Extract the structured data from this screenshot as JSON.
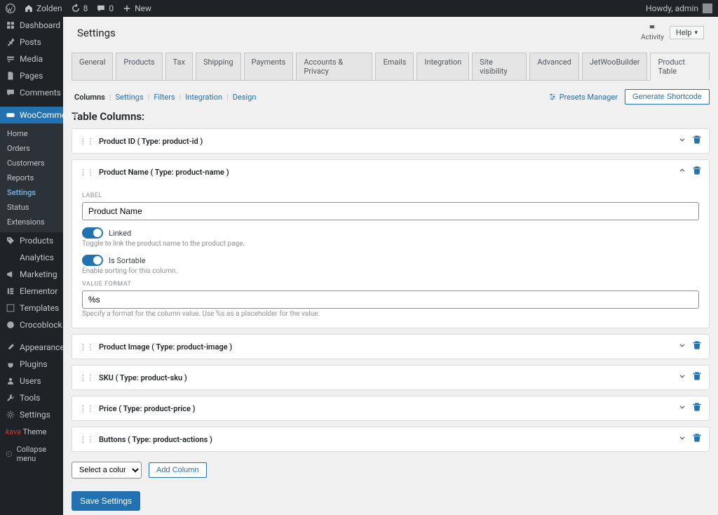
{
  "topbar": {
    "site_name": "Zolden",
    "updates_count": "8",
    "comments_count": "0",
    "new_label": "New",
    "howdy": "Howdy, admin"
  },
  "sidebar": {
    "items": [
      {
        "icon": "dashboard",
        "label": "Dashboard"
      },
      {
        "icon": "pin",
        "label": "Posts"
      },
      {
        "icon": "media",
        "label": "Media"
      },
      {
        "icon": "page",
        "label": "Pages"
      },
      {
        "icon": "comment",
        "label": "Comments"
      },
      {
        "icon": "woo",
        "label": "WooCommerce",
        "active": true
      },
      {
        "icon": "tag",
        "label": "Products"
      },
      {
        "icon": "chart",
        "label": "Analytics"
      },
      {
        "icon": "megaphone",
        "label": "Marketing"
      },
      {
        "icon": "elementor",
        "label": "Elementor"
      },
      {
        "icon": "template",
        "label": "Templates"
      },
      {
        "icon": "croco",
        "label": "Crocoblock"
      },
      {
        "icon": "brush",
        "label": "Appearance"
      },
      {
        "icon": "plugin",
        "label": "Plugins"
      },
      {
        "icon": "user",
        "label": "Users"
      },
      {
        "icon": "tool",
        "label": "Tools"
      },
      {
        "icon": "gear",
        "label": "Settings"
      }
    ],
    "submenu": [
      "Home",
      "Orders",
      "Customers",
      "Reports",
      "Settings",
      "Status",
      "Extensions"
    ],
    "submenu_active": "Settings",
    "theme_prefix": "kava",
    "theme_label": "Theme",
    "collapse_label": "Collapse menu"
  },
  "header": {
    "title": "Settings",
    "activity_label": "Activity",
    "help_label": "Help"
  },
  "tabs": [
    "General",
    "Products",
    "Tax",
    "Shipping",
    "Payments",
    "Accounts & Privacy",
    "Emails",
    "Integration",
    "Site visibility",
    "Advanced",
    "JetWooBuilder",
    "Product Table"
  ],
  "active_tab": "Product Table",
  "subtabs": [
    "Columns",
    "Settings",
    "Filters",
    "Integration",
    "Design"
  ],
  "active_subtab": "Columns",
  "subtabs_actions": {
    "presets_label": "Presets Manager",
    "generate_label": "Generate Shortcode"
  },
  "section_title": "Table Columns:",
  "columns": [
    {
      "title": "Product ID ( Type: product-id )",
      "expanded": false
    },
    {
      "title": "Product Name ( Type: product-name )",
      "expanded": true,
      "label_field": "LABEL",
      "label_value": "Product Name",
      "linked_label": "Linked",
      "linked_help": "Toggle to link the product name to the product page.",
      "sortable_label": "Is Sortable",
      "sortable_help": "Enable sorting for this column.",
      "value_format_label": "VALUE FORMAT",
      "value_format_value": "%s",
      "value_format_help": "Specify a format for the column value. Use %s as a placeholder for the value."
    },
    {
      "title": "Product Image ( Type: product-image )",
      "expanded": false
    },
    {
      "title": "SKU ( Type: product-sku )",
      "expanded": false
    },
    {
      "title": "Price ( Type: product-price )",
      "expanded": false
    },
    {
      "title": "Buttons ( Type: product-actions )",
      "expanded": false
    }
  ],
  "add_row": {
    "select_placeholder": "Select a column...",
    "add_label": "Add Column"
  },
  "save_label": "Save Settings"
}
